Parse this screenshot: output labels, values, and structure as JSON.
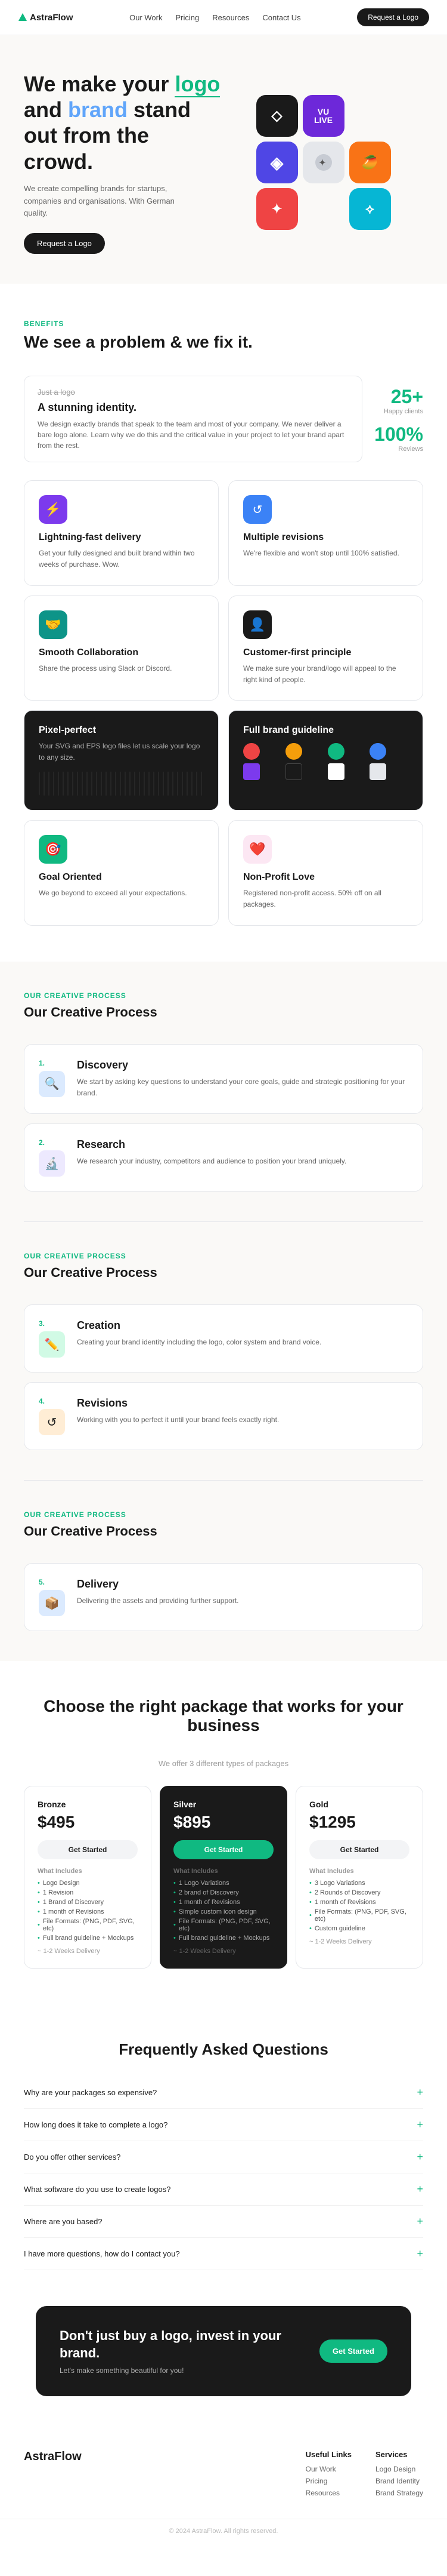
{
  "nav": {
    "logo": "AstraFlow",
    "links": [
      "Our Work",
      "Pricing",
      "Resources",
      "Contact Us"
    ],
    "cta": "Request a Logo"
  },
  "hero": {
    "title_pre": "We make your ",
    "title_accent1": "logo",
    "title_mid": " and ",
    "title_accent2": "brand",
    "title_post": " stand out from the crowd.",
    "subtitle": "We create compelling brands for startups, companies and organisations. With German quality.",
    "cta": "Request a Logo"
  },
  "benefits": {
    "label": "Benefits",
    "title": "We see a problem & we fix it.",
    "strike": "Just a logo",
    "stunning_title": "A stunning identity.",
    "stunning_desc": "We design exactly brands that speak to the team and most of your company. We never deliver a bare logo alone. Learn why we do this and the critical value in your project to let your brand apart from the rest.",
    "stat1_num": "25",
    "stat1_suffix": "+",
    "stat1_label": "Happy clients",
    "stat2_num": "100",
    "stat2_suffix": "%",
    "stat2_label": "Reviews",
    "cards": [
      {
        "icon": "⚡",
        "icon_class": "ci-purple",
        "title": "Lightning-fast delivery",
        "desc": "Get your fully designed and built brand within two weeks of purchase. Wow."
      },
      {
        "icon": "↺",
        "icon_class": "ci-blue",
        "title": "Multiple revisions",
        "desc": "We're flexible and won't stop until 100% satisfied."
      },
      {
        "icon": "🤝",
        "icon_class": "ci-teal",
        "title": "Smooth Collaboration",
        "desc": "Share the process using Slack or Discord."
      },
      {
        "icon": "👤",
        "icon_class": "ci-dark",
        "title": "Customer-first principle",
        "desc": "We make sure your brand/logo will appeal to the right kind of people."
      },
      {
        "icon": "⬛",
        "icon_class": "ci-dark",
        "title": "Pixel-perfect",
        "desc": "Your SVG and EPS logo files let us scale your logo to any size.",
        "dark": true
      },
      {
        "icon": "📖",
        "icon_class": "ci-dark",
        "title": "Full brand guideline",
        "desc": "",
        "dark": true,
        "brand": true
      },
      {
        "icon": "🎯",
        "icon_class": "ci-green",
        "title": "Goal Oriented",
        "desc": "We go beyond to exceed all your expectations."
      },
      {
        "icon": "❤️",
        "icon_class": "ci-pink",
        "title": "Non-Profit Love",
        "desc": "Registered non-profit access. 50% off on all packages."
      }
    ]
  },
  "process": {
    "label": "Our Creative Process",
    "steps": [
      {
        "num": "1.",
        "icon": "🔍",
        "icon_class": "pi-blue",
        "title": "Discovery",
        "desc": "We start by asking key questions to understand your core goals, guide and strategic positioning for your brand."
      },
      {
        "num": "2.",
        "icon": "🔬",
        "icon_class": "pi-purple",
        "title": "Research",
        "desc": "We research your industry, competitors and audience to position your brand uniquely."
      },
      {
        "num": "3.",
        "icon": "✏️",
        "icon_class": "pi-green",
        "title": "Creation",
        "desc": "Creating your brand identity including the logo, color system and brand voice."
      },
      {
        "num": "4.",
        "icon": "↺",
        "icon_class": "pi-orange",
        "title": "Revisions",
        "desc": "Working with you to perfect it until your brand feels exactly right."
      },
      {
        "num": "5.",
        "icon": "📦",
        "icon_class": "pi-blue",
        "title": "Delivery",
        "desc": "Delivering the assets and providing further support."
      }
    ]
  },
  "pricing": {
    "title": "Choose the right package that works for your business",
    "subtitle": "We offer 3 different types of packages",
    "plans": [
      {
        "tier": "Bronze",
        "price": "$495",
        "btn": "Get Started",
        "btn_class": "pb-light",
        "dark": false,
        "includes_label": "What Includes",
        "features": [
          "Logo Design",
          "1 Revision",
          "1 Brand of Discovery",
          "1 month of Revisions",
          "File Formats: (PNG, PDF, SVG, etc)",
          "Full brand guideline + Mockups"
        ],
        "delivery": "~ 1-2 Weeks Delivery"
      },
      {
        "tier": "Silver",
        "price": "$895",
        "btn": "Get Started",
        "btn_class": "pb-green",
        "dark": true,
        "includes_label": "What Includes",
        "features": [
          "1 Logo Variations",
          "2 brand of Discovery",
          "1 month of Revisions",
          "Simple custom icon design",
          "File Formats: (PNG, PDF, SVG, etc)",
          "Full brand guideline + Mockups"
        ],
        "delivery": "~ 1-2 Weeks Delivery"
      },
      {
        "tier": "Gold",
        "price": "$1295",
        "btn": "Get Started",
        "btn_class": "pb-light",
        "dark": false,
        "includes_label": "What Includes",
        "features": [
          "3 Logo Variations",
          "2 Rounds of Discovery",
          "1 month of Revisions",
          "File Formats: (PNG, PDF, SVG, etc)",
          "Custom guideline"
        ],
        "delivery": "~ 1-2 Weeks Delivery"
      }
    ]
  },
  "faq": {
    "title": "Frequently Asked Questions",
    "items": [
      {
        "q": "Why are your packages so expensive?"
      },
      {
        "q": "How long does it take to complete a logo?"
      },
      {
        "q": "Do you offer other services?"
      },
      {
        "q": "What software do you use to create logos?"
      },
      {
        "q": "Where are you based?"
      },
      {
        "q": "I have more questions, how do I contact you?"
      }
    ]
  },
  "cta": {
    "title": "Don't just buy a logo, invest in your brand.",
    "subtitle": "Let's make something beautiful for you!",
    "btn": "Get Started"
  },
  "footer": {
    "brand": "AstraFlow",
    "useful_links_title": "Useful Links",
    "useful_links": [
      "Our Work",
      "Pricing",
      "Resources"
    ],
    "services_title": "Services",
    "services": [
      "Logo Design",
      "Brand Identity",
      "Brand Strategy"
    ],
    "bottom": "© 2024 AstraFlow. All rights reserved."
  }
}
